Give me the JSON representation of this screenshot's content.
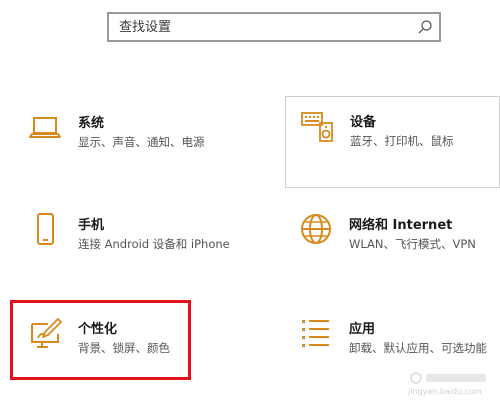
{
  "search": {
    "placeholder": "查找设置"
  },
  "tiles": [
    {
      "title": "系统",
      "desc": "显示、声音、通知、电源",
      "icon": "laptop-icon"
    },
    {
      "title": "设备",
      "desc": "蓝牙、打印机、鼠标",
      "icon": "devices-icon"
    },
    {
      "title": "手机",
      "desc": "连接 Android 设备和 iPhone",
      "icon": "phone-icon"
    },
    {
      "title": "网络和 Internet",
      "desc": "WLAN、飞行模式、VPN",
      "icon": "globe-icon"
    },
    {
      "title": "个性化",
      "desc": "背景、锁屏、颜色",
      "icon": "personalization-icon"
    },
    {
      "title": "应用",
      "desc": "卸载、默认应用、可选功能",
      "icon": "apps-list-icon"
    }
  ],
  "colors": {
    "accent": "#d98a1e",
    "highlight": "#e3131c"
  },
  "watermark": {
    "text": "jingyan.baidu.com"
  }
}
